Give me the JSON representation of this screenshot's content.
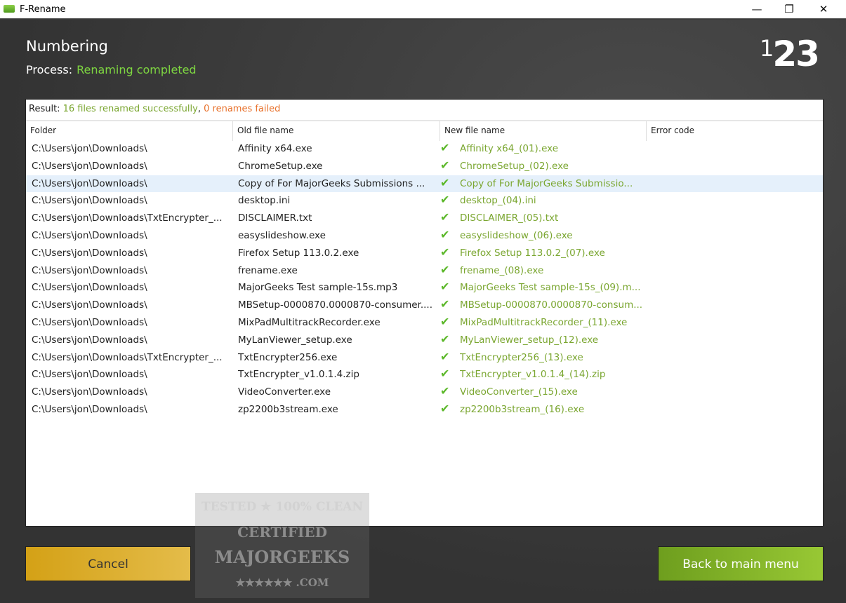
{
  "window": {
    "title": "F-Rename",
    "minimize": "—",
    "restore": "❐",
    "close": "✕"
  },
  "header": {
    "title": "Numbering",
    "process_label": "Process:",
    "process_value": "Renaming completed",
    "logo_1": "1",
    "logo_23": "23"
  },
  "result": {
    "label": "Result:",
    "success": "16 files renamed successfully",
    "sep": ",",
    "failed": "0 renames failed"
  },
  "columns": [
    "Folder",
    "Old file name",
    "New file name",
    "Error code"
  ],
  "rows": [
    {
      "folder": "C:\\Users\\jon\\Downloads\\",
      "old": "Affinity x64.exe",
      "new": "Affinity x64_(01).exe"
    },
    {
      "folder": "C:\\Users\\jon\\Downloads\\",
      "old": "ChromeSetup.exe",
      "new": "ChromeSetup_(02).exe"
    },
    {
      "folder": "C:\\Users\\jon\\Downloads\\",
      "old": "Copy of For MajorGeeks Submissions ...",
      "new": "Copy of For MajorGeeks Submissio..."
    },
    {
      "folder": "C:\\Users\\jon\\Downloads\\",
      "old": "desktop.ini",
      "new": "desktop_(04).ini"
    },
    {
      "folder": "C:\\Users\\jon\\Downloads\\TxtEncrypter_...",
      "old": "DISCLAIMER.txt",
      "new": "DISCLAIMER_(05).txt"
    },
    {
      "folder": "C:\\Users\\jon\\Downloads\\",
      "old": "easyslideshow.exe",
      "new": "easyslideshow_(06).exe"
    },
    {
      "folder": "C:\\Users\\jon\\Downloads\\",
      "old": "Firefox Setup 113.0.2.exe",
      "new": "Firefox Setup 113.0.2_(07).exe"
    },
    {
      "folder": "C:\\Users\\jon\\Downloads\\",
      "old": "frename.exe",
      "new": "frename_(08).exe"
    },
    {
      "folder": "C:\\Users\\jon\\Downloads\\",
      "old": "MajorGeeks Test sample-15s.mp3",
      "new": "MajorGeeks Test sample-15s_(09).m..."
    },
    {
      "folder": "C:\\Users\\jon\\Downloads\\",
      "old": "MBSetup-0000870.0000870-consumer....",
      "new": "MBSetup-0000870.0000870-consum..."
    },
    {
      "folder": "C:\\Users\\jon\\Downloads\\",
      "old": "MixPadMultitrackRecorder.exe",
      "new": "MixPadMultitrackRecorder_(11).exe"
    },
    {
      "folder": "C:\\Users\\jon\\Downloads\\",
      "old": "MyLanViewer_setup.exe",
      "new": "MyLanViewer_setup_(12).exe"
    },
    {
      "folder": "C:\\Users\\jon\\Downloads\\TxtEncrypter_...",
      "old": "TxtEncrypter256.exe",
      "new": "TxtEncrypter256_(13).exe"
    },
    {
      "folder": "C:\\Users\\jon\\Downloads\\",
      "old": "TxtEncrypter_v1.0.1.4.zip",
      "new": "TxtEncrypter_v1.0.1.4_(14).zip"
    },
    {
      "folder": "C:\\Users\\jon\\Downloads\\",
      "old": "VideoConverter.exe",
      "new": "VideoConverter_(15).exe"
    },
    {
      "folder": "C:\\Users\\jon\\Downloads\\",
      "old": "zp2200b3stream.exe",
      "new": "zp2200b3stream_(16).exe"
    }
  ],
  "check_icon": "✔",
  "watermark": {
    "line1": "TESTED ★ 100% CLEAN",
    "line2": "CERTIFIED",
    "line3": "MAJORGEEKS",
    "line4": "★★★★★★ .COM"
  },
  "buttons": {
    "cancel": "Cancel",
    "back": "Back to main menu"
  },
  "colors": {
    "success": "#7aa630",
    "fail": "#e8702a",
    "process": "#7ed641",
    "selected_row": "#e5f0fb"
  }
}
